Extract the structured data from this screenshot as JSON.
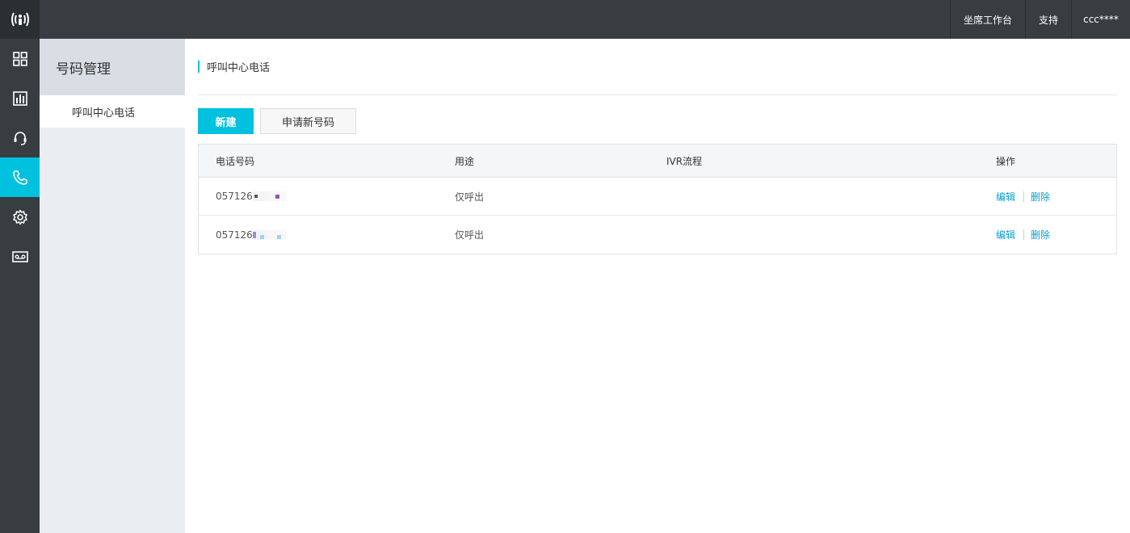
{
  "topbar": {
    "logo_icon": "signal-person-icon",
    "items": [
      {
        "label": "坐席工作台"
      },
      {
        "label": "支持"
      },
      {
        "label": "ccc****"
      }
    ]
  },
  "iconbar": {
    "items": [
      {
        "icon": "grid-icon",
        "active": false
      },
      {
        "icon": "bar-chart-icon",
        "active": false
      },
      {
        "icon": "headset-icon",
        "active": false
      },
      {
        "icon": "phone-icon",
        "active": true
      },
      {
        "icon": "gear-icon",
        "active": false
      },
      {
        "icon": "voicemail-icon",
        "active": false
      }
    ]
  },
  "sidenav": {
    "title": "号码管理",
    "items": [
      {
        "label": "呼叫中心电话"
      }
    ]
  },
  "main": {
    "title": "呼叫中心电话",
    "new_button": "新建",
    "apply_button": "申请新号码",
    "table": {
      "columns": [
        "电话号码",
        "用途",
        "IVR流程",
        "操作"
      ],
      "rows": [
        {
          "phone": "057126",
          "usage": "仅呼出",
          "ivr": "",
          "edit": "编辑",
          "delete": "删除"
        },
        {
          "phone": "057126",
          "usage": "仅呼出",
          "ivr": "",
          "edit": "编辑",
          "delete": "删除"
        }
      ]
    }
  },
  "colors": {
    "accent": "#00c1de",
    "topbar": "#373d41",
    "link": "#0ba0c9"
  }
}
